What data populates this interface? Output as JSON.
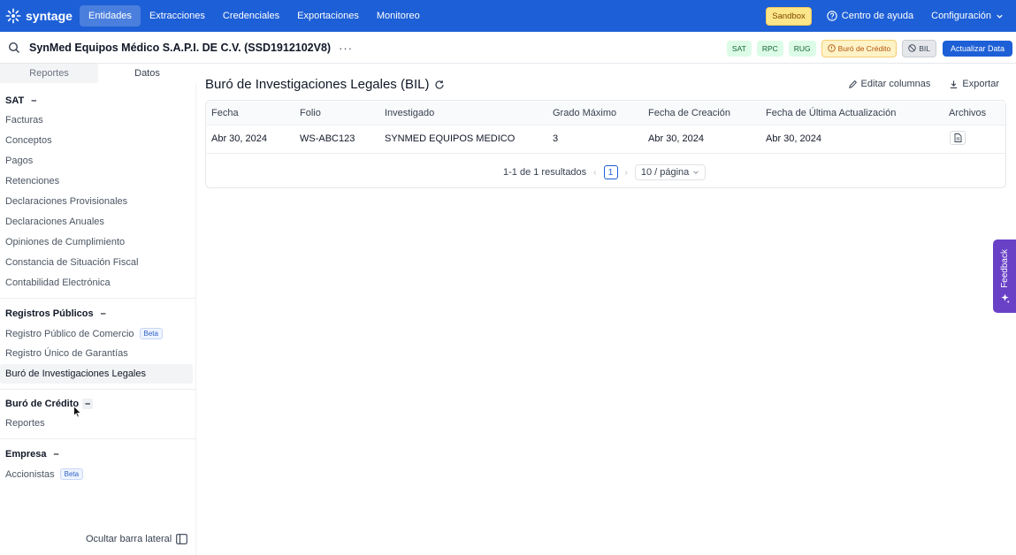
{
  "app": {
    "brand": "syntage"
  },
  "topnav": {
    "items": [
      {
        "label": "Entidades",
        "active": true
      },
      {
        "label": "Extracciones"
      },
      {
        "label": "Credenciales"
      },
      {
        "label": "Exportaciones"
      },
      {
        "label": "Monitoreo"
      }
    ],
    "sandbox": "Sandbox",
    "help": "Centro de ayuda",
    "config": "Configuración"
  },
  "entity": {
    "name": "SynMed Equipos Médico S.A.P.I. DE C.V. (SSD1912102V8)",
    "more": "···",
    "badges": [
      "SAT",
      "RPC",
      "RUG",
      "Buró de Crédito",
      "BIL"
    ],
    "update_button": "Actualizar Data"
  },
  "sidebar": {
    "tabs": [
      "Reportes",
      "Datos"
    ],
    "sections": [
      {
        "title": "SAT",
        "items": [
          "Facturas",
          "Conceptos",
          "Pagos",
          "Retenciones",
          "Declaraciones Provisionales",
          "Declaraciones Anuales",
          "Opiniones de Cumplimiento",
          "Constancia de Situación Fiscal",
          "Contabilidad Electrónica"
        ]
      },
      {
        "title": "Registros Públicos",
        "items": [
          "Registro Público de Comercio",
          "Registro Único de Garantías",
          "Buró de Investigaciones Legales"
        ]
      },
      {
        "title": "Buró de Crédito",
        "items": [
          "Reportes"
        ]
      },
      {
        "title": "Empresa",
        "items": [
          "Accionistas"
        ]
      }
    ],
    "beta_label": "Beta",
    "collapse_symbol": "–",
    "hide": "Ocultar barra lateral"
  },
  "main": {
    "title": "Buró de Investigaciones Legales (BIL)",
    "actions": {
      "edit": "Editar columnas",
      "export": "Exportar"
    },
    "table": {
      "columns": [
        "Fecha",
        "Folio",
        "Investigado",
        "Grado Máximo",
        "Fecha de Creación",
        "Fecha de Última Actualización",
        "Archivos"
      ],
      "rows": [
        [
          "Abr 30, 2024",
          "WS-ABC123",
          "SYNMED EQUIPOS MEDICO",
          "3",
          "Abr 30, 2024",
          "Abr 30, 2024"
        ]
      ]
    },
    "pagination": {
      "summary": "1-1 de 1 resultados",
      "current_page": "1",
      "page_size": "10 / página"
    }
  },
  "feedback": "Feedback",
  "colors": {
    "primary": "#1d5fd6",
    "sandbox": "#fde68a",
    "feedback": "#6941c6",
    "badge_green": "#dcfce7"
  }
}
